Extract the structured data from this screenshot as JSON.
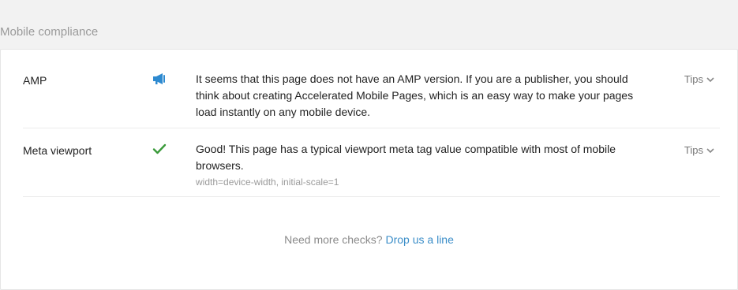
{
  "section": {
    "title": "Mobile compliance"
  },
  "rows": [
    {
      "name": "AMP",
      "icon": "megaphone-icon",
      "status_color": "#2e8ad0",
      "text": "It seems that this page does not have an AMP version. If you are a publisher, you should think about creating Accelerated Mobile Pages, which is an easy way to make your pages load instantly on any mobile device.",
      "tips_label": "Tips"
    },
    {
      "name": "Meta viewport",
      "icon": "checkmark-icon",
      "status_color": "#3a9a3a",
      "text": "Good! This page has a typical viewport meta tag value compatible with most of mobile browsers.",
      "detail": "width=device-width, initial-scale=1",
      "tips_label": "Tips"
    }
  ],
  "footer": {
    "prompt": "Need more checks?",
    "link_label": "Drop us a line",
    "link_color": "#3a8dc8"
  }
}
